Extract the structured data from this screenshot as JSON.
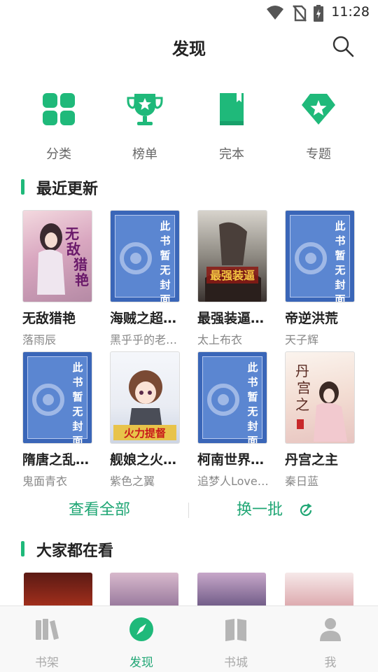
{
  "status": {
    "time": "11:28"
  },
  "header": {
    "title": "发现"
  },
  "categories": [
    {
      "label": "分类",
      "icon": "grid-icon"
    },
    {
      "label": "榜单",
      "icon": "trophy-icon"
    },
    {
      "label": "完本",
      "icon": "book-icon"
    },
    {
      "label": "专题",
      "icon": "star-badge-icon"
    }
  ],
  "recent": {
    "heading": "最近更新",
    "books": [
      {
        "title": "无敌猎艳",
        "author": "落雨辰"
      },
      {
        "title": "海贼之超…",
        "author": "黑乎乎的老…",
        "cover_text": "此书暂无封面"
      },
      {
        "title": "最强装逼…",
        "author": "太上布衣"
      },
      {
        "title": "帝逆洪荒",
        "author": "天子辉",
        "cover_text": "此书暂无封面"
      },
      {
        "title": "隋唐之乱…",
        "author": "鬼面青衣",
        "cover_text": "此书暂无封面"
      },
      {
        "title": "舰娘之火…",
        "author": "紫色之翼"
      },
      {
        "title": "柯南世界…",
        "author": "追梦人Love…",
        "cover_text": "此书暂无封面"
      },
      {
        "title": "丹宫之主",
        "author": "秦日蓝"
      }
    ],
    "view_all": "查看全部",
    "refresh": "换一批"
  },
  "popular": {
    "heading": "大家都在看"
  },
  "tabs": [
    {
      "label": "书架",
      "icon": "bookshelf-icon"
    },
    {
      "label": "发现",
      "icon": "compass-icon",
      "active": true
    },
    {
      "label": "书城",
      "icon": "store-book-icon"
    },
    {
      "label": "我",
      "icon": "person-icon"
    }
  ],
  "colors": {
    "accent": "#1fb97a",
    "accent_text": "#1fa674"
  }
}
